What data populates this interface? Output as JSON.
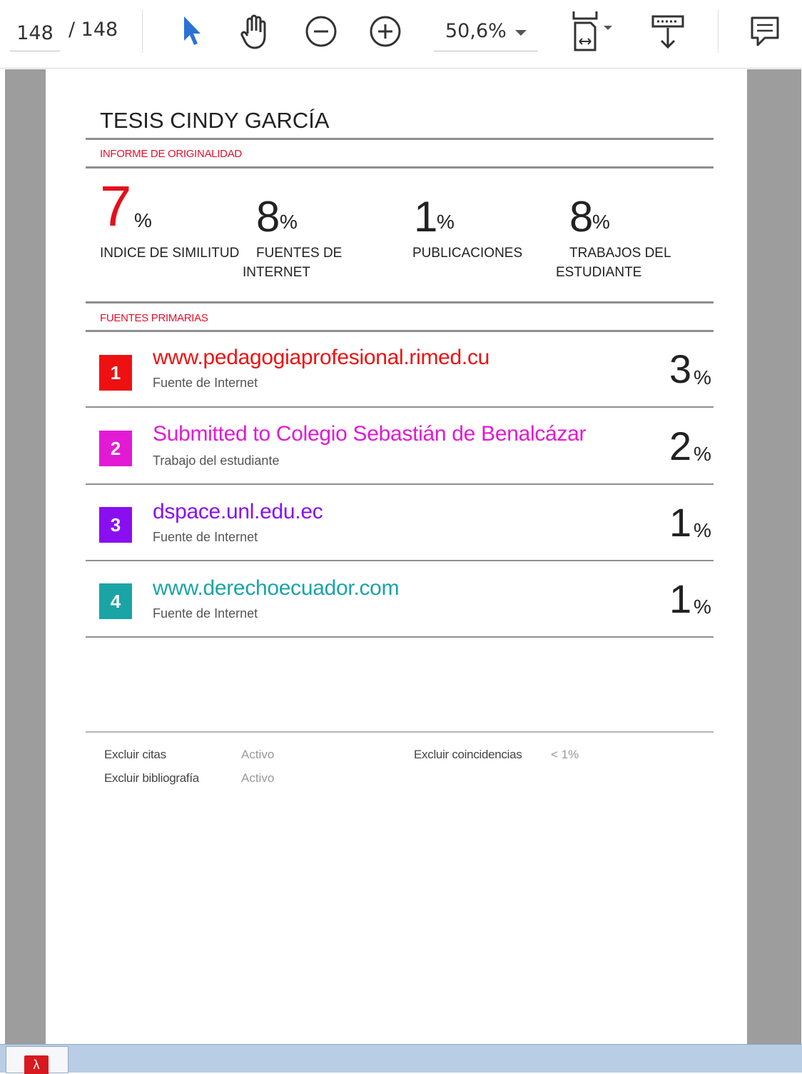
{
  "toolbar": {
    "page_current": "148",
    "page_total": "/ 148",
    "zoom": "50,6%",
    "icons": [
      "select-arrow-icon",
      "hand-tool-icon",
      "zoom-out-icon",
      "zoom-in-icon",
      "fit-page-icon",
      "download-icon",
      "comment-icon"
    ]
  },
  "report": {
    "title": "TESIS CINDY GARCÍA",
    "originality_heading": "INFORME DE ORIGINALIDAD",
    "stats": [
      {
        "value": "7",
        "pct": "%",
        "label_line1": "INDICE DE SIMILITUD",
        "label_line2": ""
      },
      {
        "value": "8",
        "pct": "%",
        "label_line1": "FUENTES DE",
        "label_line2": "INTERNET"
      },
      {
        "value": "1",
        "pct": "%",
        "label_line1": "PUBLICACIONES",
        "label_line2": ""
      },
      {
        "value": "8",
        "pct": "%",
        "label_line1": "TRABAJOS DEL",
        "label_line2": "ESTUDIANTE"
      }
    ],
    "primary_heading": "FUENTES PRIMARIAS",
    "sources": [
      {
        "num": "1",
        "title": "www.pedagogiaprofesional.rimed.cu",
        "type": "Fuente de Internet",
        "pct": "3",
        "pct_sym": "%",
        "color": "#ee1111"
      },
      {
        "num": "2",
        "title": "Submitted to Colegio Sebastián de Benalcázar",
        "type": "Trabajo del estudiante",
        "pct": "2",
        "pct_sym": "%",
        "color": "#e21ad4"
      },
      {
        "num": "3",
        "title": "dspace.unl.edu.ec",
        "type": "Fuente de Internet",
        "pct": "1",
        "pct_sym": "%",
        "color": "#8a0ff0"
      },
      {
        "num": "4",
        "title": "www.derechoecuador.com",
        "type": "Fuente de Internet",
        "pct": "1",
        "pct_sym": "%",
        "color": "#1aa4a6"
      }
    ],
    "footer": {
      "excluir_citas_label": "Excluir citas",
      "excluir_citas_val": "Activo",
      "excluir_bibliografia_label": "Excluir bibliografía",
      "excluir_bibliografia_val": "Activo",
      "excluir_coincidencias_label": "Excluir coincidencias",
      "excluir_coincidencias_val": "< 1%"
    }
  },
  "colors": {
    "accent_red": "#e8102a",
    "viewer_bg": "#9d9d9d",
    "taskbar": "#b9cde5"
  }
}
